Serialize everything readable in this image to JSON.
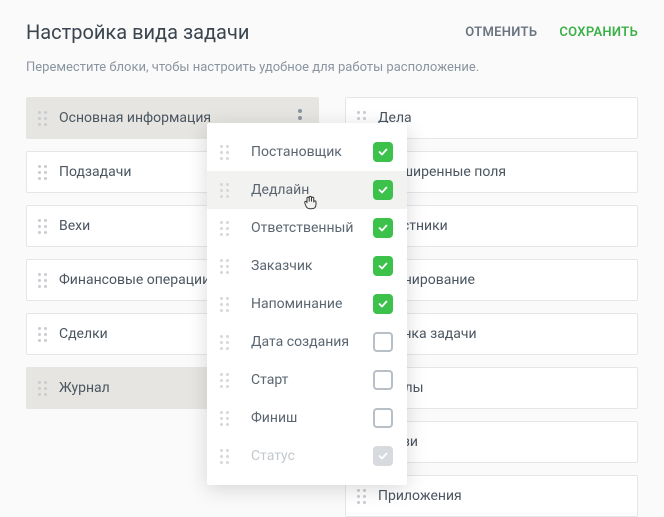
{
  "header": {
    "title": "Настройка вида задачи",
    "cancel": "ОТМЕНИТЬ",
    "save": "СОХРАНИТЬ"
  },
  "hint": "Переместите блоки, чтобы настроить удобное для работы расположение.",
  "left_column": [
    {
      "label": "Основная информация",
      "shaded": true,
      "showKebab": true
    },
    {
      "label": "Подзадачи",
      "shaded": false
    },
    {
      "label": "Вехи",
      "shaded": false
    },
    {
      "label": "Финансовые операции",
      "shaded": false
    },
    {
      "label": "Сделки",
      "shaded": false
    },
    {
      "label": "Журнал",
      "shaded": true
    }
  ],
  "right_column": [
    {
      "label": "Дела"
    },
    {
      "label": "Расширенные поля"
    },
    {
      "label": "Участники"
    },
    {
      "label": "Планирование"
    },
    {
      "label": "Оценка задачи"
    },
    {
      "label": "Файлы"
    },
    {
      "label": "Связи"
    },
    {
      "label": "Приложения"
    }
  ],
  "fields_panel": [
    {
      "label": "Постановщик",
      "state": "checked"
    },
    {
      "label": "Дедлайн",
      "state": "checked",
      "hovered": true
    },
    {
      "label": "Ответственный",
      "state": "checked"
    },
    {
      "label": "Заказчик",
      "state": "checked"
    },
    {
      "label": "Напоминание",
      "state": "checked"
    },
    {
      "label": "Дата создания",
      "state": "unchecked"
    },
    {
      "label": "Старт",
      "state": "unchecked"
    },
    {
      "label": "Финиш",
      "state": "unchecked"
    },
    {
      "label": "Статус",
      "state": "disabled"
    }
  ]
}
